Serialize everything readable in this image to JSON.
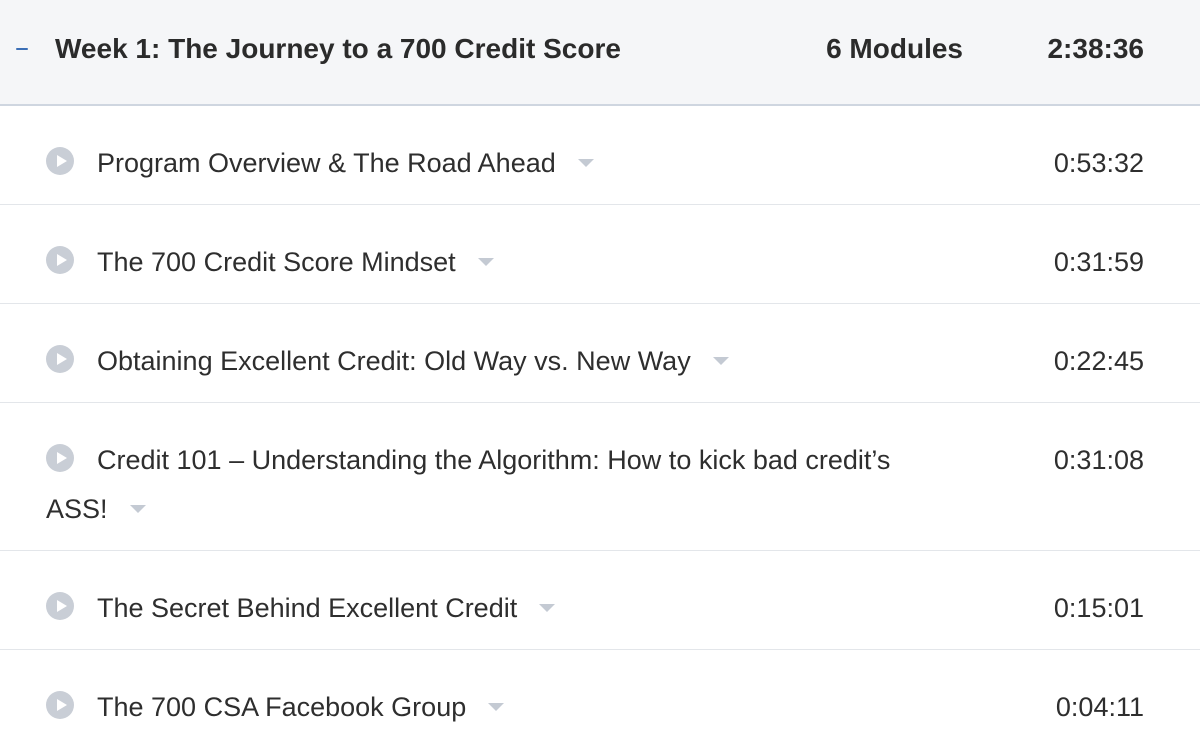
{
  "week": {
    "toggle_icon": "minus-icon",
    "title": "Week 1: The Journey to a 700 Credit Score",
    "module_count": "6 Modules",
    "duration": "2:38:36",
    "accent_color": "#3c6fb6"
  },
  "lessons": [
    {
      "title": "Program Overview & The Road Ahead",
      "duration": "0:53:32",
      "icon": "play-circle-icon",
      "expand_icon": "caret-down-icon"
    },
    {
      "title": "The 700 Credit Score Mindset",
      "duration": "0:31:59",
      "icon": "play-circle-icon",
      "expand_icon": "caret-down-icon"
    },
    {
      "title": "Obtaining Excellent Credit: Old Way vs. New Way",
      "duration": "0:22:45",
      "icon": "play-circle-icon",
      "expand_icon": "caret-down-icon"
    },
    {
      "title": "Credit 101 – Understanding the Algorithm: How to kick bad credit’s ASS!",
      "duration": "0:31:08",
      "icon": "play-circle-icon",
      "expand_icon": "caret-down-icon"
    },
    {
      "title": "The Secret Behind Excellent Credit",
      "duration": "0:15:01",
      "icon": "play-circle-icon",
      "expand_icon": "caret-down-icon"
    },
    {
      "title": "The 700 CSA Facebook Group",
      "duration": "0:04:11",
      "icon": "play-circle-icon",
      "expand_icon": "caret-down-icon"
    }
  ]
}
